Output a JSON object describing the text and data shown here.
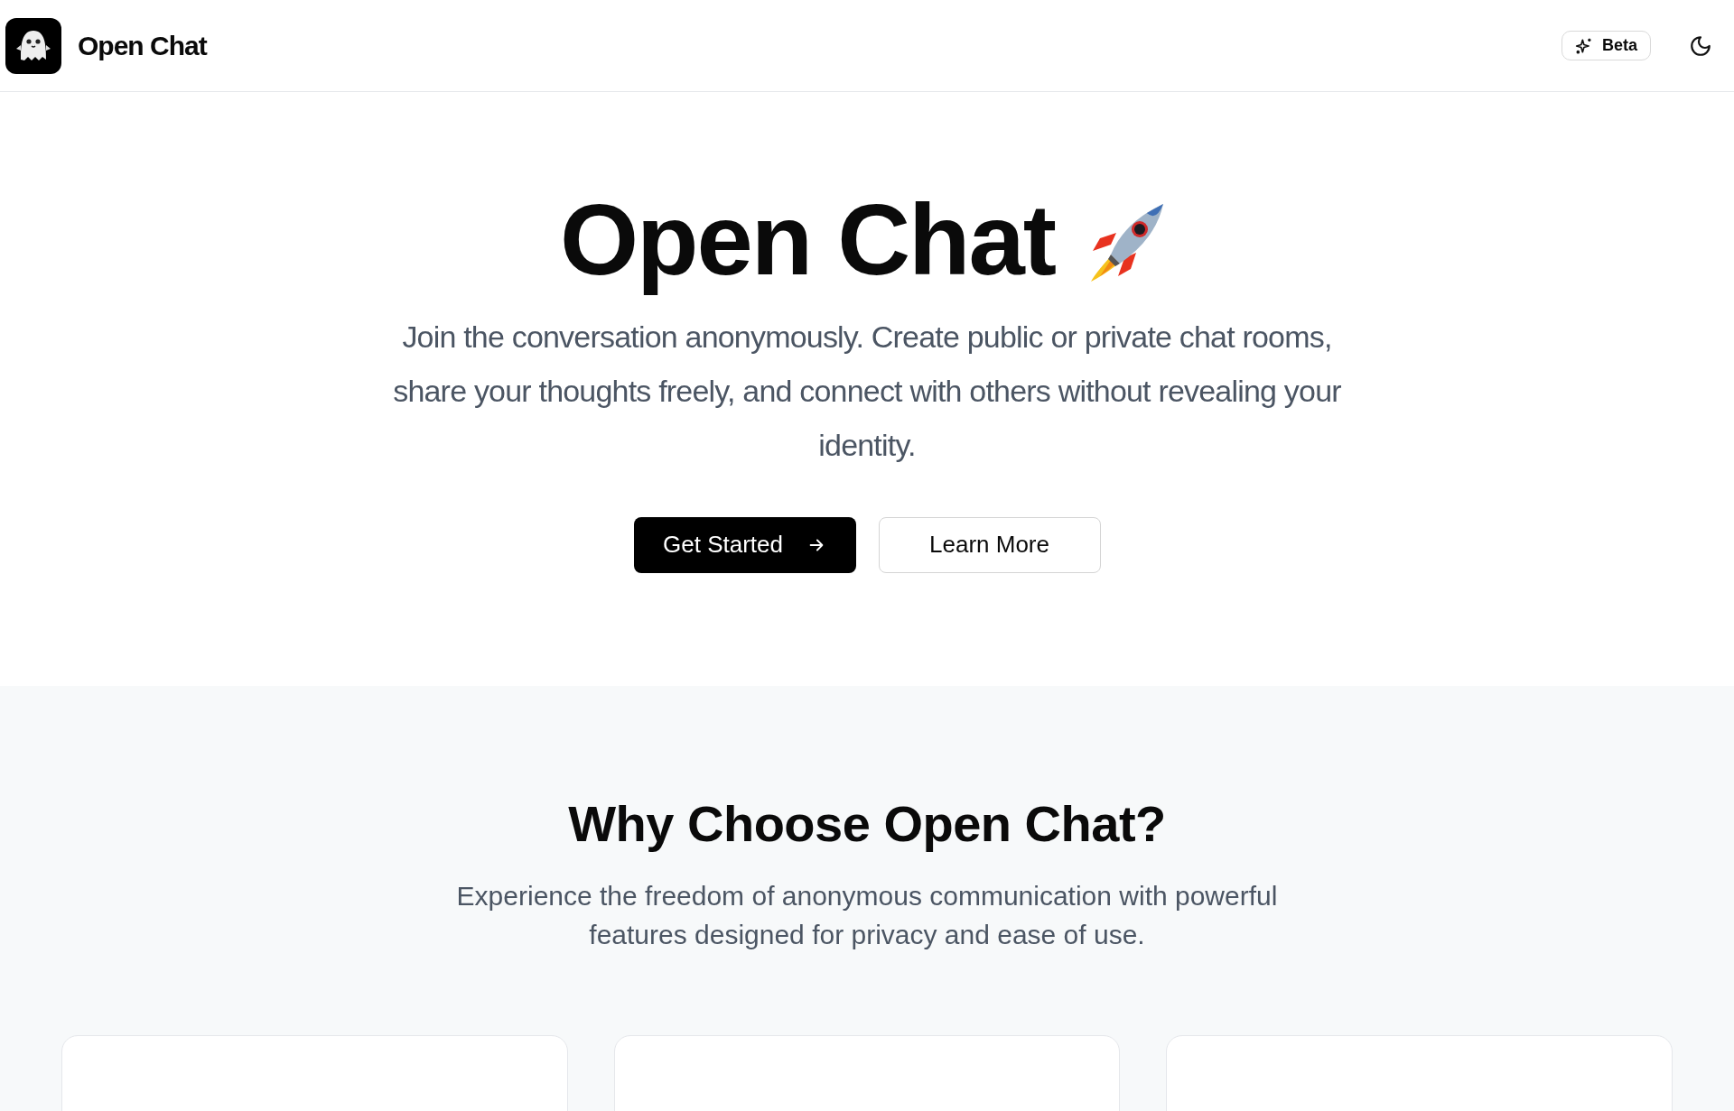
{
  "header": {
    "brand": "Open Chat",
    "badge": "Beta",
    "theme_toggle": {
      "dark_mode": false
    }
  },
  "hero": {
    "title": "Open Chat",
    "subtitle": "Join the conversation anonymously. Create public or private chat rooms, share your thoughts freely, and connect with others without revealing your identity.",
    "buttons": [
      {
        "label": "Get Started",
        "kind": "primary"
      },
      {
        "label": "Learn More",
        "kind": "secondary"
      }
    ]
  },
  "features": {
    "title": "Why Choose Open Chat?",
    "description": "Experience the freedom of anonymous communication with powerful features designed for privacy and ease of use.",
    "cards": [
      {
        "kind": "blank"
      },
      {
        "kind": "blank"
      },
      {
        "kind": "blank"
      }
    ]
  }
}
